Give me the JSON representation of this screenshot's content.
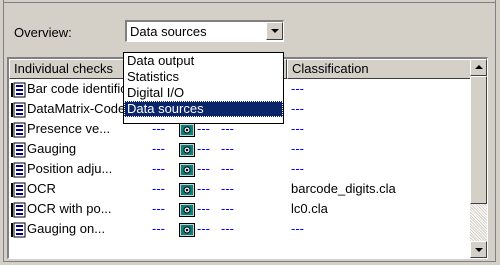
{
  "overview": {
    "label": "Overview:",
    "selected": "Data sources",
    "options": [
      "Data output",
      "Statistics",
      "Digital I/O",
      "Data sources"
    ]
  },
  "table": {
    "columns": [
      "Individual checks",
      "",
      "",
      "Classification"
    ],
    "rows": [
      {
        "name": "Bar code identification",
        "d1": "",
        "d2": "",
        "d3": "",
        "classification": "---"
      },
      {
        "name": "DataMatrix-Code",
        "d1": "",
        "d2": "",
        "d3": "",
        "classification": "---"
      },
      {
        "name": "Presence ve...",
        "d1": "---",
        "d2": "---",
        "d3": "---",
        "classification": "---"
      },
      {
        "name": "Gauging",
        "d1": "---",
        "d2": "---",
        "d3": "---",
        "classification": "---"
      },
      {
        "name": "Position adju...",
        "d1": "---",
        "d2": "---",
        "d3": "---",
        "classification": "---"
      },
      {
        "name": "OCR",
        "d1": "---",
        "d2": "---",
        "d3": "---",
        "classification": "barcode_digits.cla"
      },
      {
        "name": "OCR with po...",
        "d1": "---",
        "d2": "---",
        "d3": "---",
        "classification": "lc0.cla"
      },
      {
        "name": "Gauging on...",
        "d1": "---",
        "d2": "---",
        "d3": "---",
        "classification": "---"
      }
    ]
  },
  "colors": {
    "selection": "#0a246a",
    "link": "#0000ff",
    "face": "#d4d0c8"
  }
}
